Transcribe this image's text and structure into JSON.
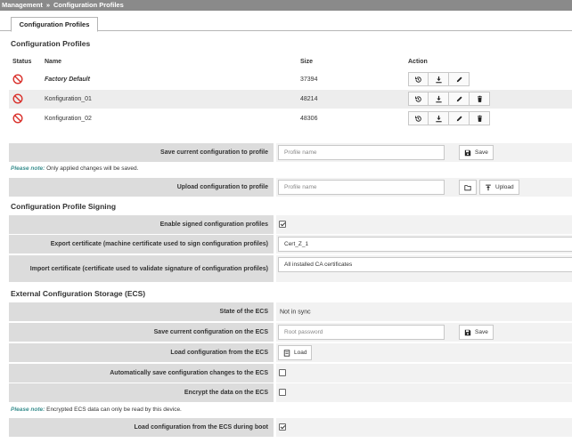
{
  "breadcrumb": {
    "section": "Management",
    "separator": "»",
    "page": "Configuration Profiles"
  },
  "tabs": [
    {
      "label": "Configuration Profiles"
    }
  ],
  "profiles": {
    "title": "Configuration Profiles",
    "headers": {
      "status": "Status",
      "name": "Name",
      "size": "Size",
      "action": "Action"
    },
    "rows": [
      {
        "name": "Factory Default",
        "size": "37394"
      },
      {
        "name": "Konfiguration_01",
        "size": "48214"
      },
      {
        "name": "Konfiguration_02",
        "size": "48306"
      }
    ]
  },
  "save_profile": {
    "label": "Save current configuration to profile",
    "placeholder": "Profile name",
    "button": "Save"
  },
  "note1": {
    "prefix": "Please note:",
    "text": "Only applied changes will be saved."
  },
  "upload_profile": {
    "label": "Upload configuration to profile",
    "placeholder": "Profile name",
    "button": "Upload"
  },
  "signing": {
    "title": "Configuration Profile Signing",
    "enable_label": "Enable signed configuration profiles",
    "enable_checked": true,
    "export_label": "Export certificate (machine certificate used to sign configuration profiles)",
    "export_value": "Cert_Z_1",
    "import_label": "Import certificate (certificate used to validate signature of configuration profiles)",
    "import_value": "All installed CA certificates"
  },
  "ecs": {
    "title": "External Configuration Storage (ECS)",
    "state_label": "State of the ECS",
    "state_value": "Not in sync",
    "save_label": "Save current configuration on the ECS",
    "save_placeholder": "Root password",
    "save_button": "Save",
    "load_label": "Load configuration from the ECS",
    "load_button": "Load",
    "autosave_label": "Automatically save configuration changes to the ECS",
    "autosave_checked": false,
    "encrypt_label": "Encrypt the data on the ECS",
    "encrypt_checked": false,
    "note_prefix": "Please note:",
    "note_text": "Encrypted ECS data can only be read by this device.",
    "boot_label": "Load configuration from the ECS during boot",
    "boot_checked": true
  },
  "colors": {
    "status_error": "#d9302b",
    "label_bg": "#dcdcdc",
    "note_accent": "#3a8f8f",
    "breadcrumb_bg": "#8a8a8a"
  }
}
